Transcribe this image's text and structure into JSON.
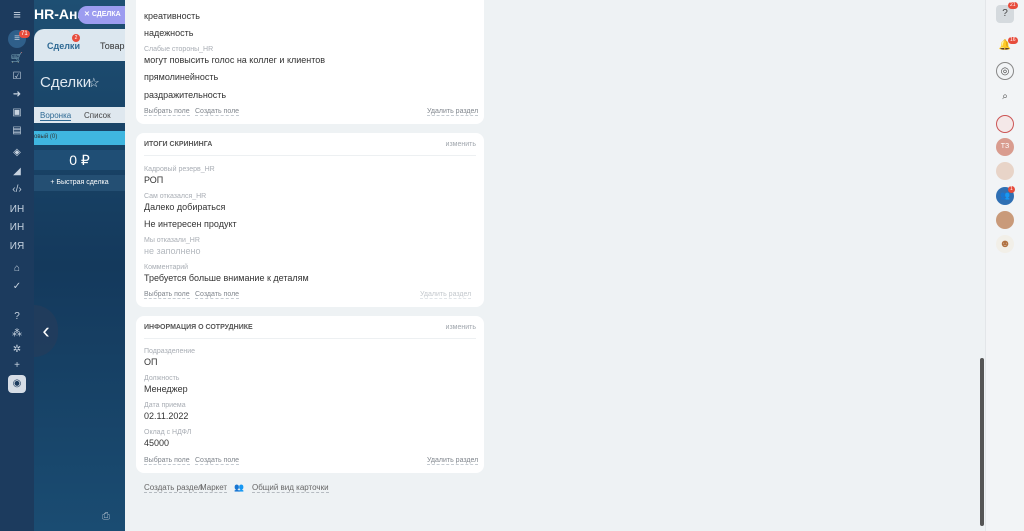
{
  "left_rail": {
    "menu_badge": "71",
    "items": [
      "ИН",
      "ИН",
      "ИЯ"
    ]
  },
  "background_app": {
    "title": "HR-Ана",
    "tabs": [
      {
        "label": "Сделки",
        "badge": "2"
      },
      {
        "label": "Товары"
      }
    ],
    "heading": "Сделки",
    "views": [
      "Воронка",
      "Список"
    ],
    "stage_label": "овый",
    "stage_count": "(0)",
    "sum": "0 ₽",
    "quick_deal": "Быстрая сделка"
  },
  "slider_chip": {
    "label": "СДЕЛКА"
  },
  "card1": {
    "fields": [
      {
        "value": "креативность"
      },
      {
        "value": "надежность"
      },
      {
        "label": "Слабые стороны_HR",
        "value": "могут повысить голос на коллег и клиентов"
      },
      {
        "value": "прямолинейность"
      },
      {
        "value": "раздражительность"
      }
    ],
    "footer": {
      "select": "Выбрать поле",
      "create": "Создать поле",
      "delete": "Удалить раздел"
    }
  },
  "card2": {
    "title": "ИТОГИ СКРИНИНГА",
    "edit": "изменить",
    "fields": [
      {
        "label": "Кадровый резерв_HR",
        "value": "РОП"
      },
      {
        "label": "Сам отказался_HR",
        "value": "Далеко добираться"
      },
      {
        "label": "",
        "value": "Не интересен продукт"
      },
      {
        "label": "Мы отказали_HR",
        "value": "не заполнено"
      },
      {
        "label": "Комментарий",
        "value": "Требуется больше внимание к деталям"
      }
    ],
    "footer": {
      "select": "Выбрать поле",
      "create": "Создать поле",
      "delete": "Удалить раздел"
    }
  },
  "card3": {
    "title": "ИНФОРМАЦИЯ О СОТРУДНИКЕ",
    "edit": "изменить",
    "fields": [
      {
        "label": "Подразделение",
        "value": "ОП"
      },
      {
        "label": "Должность",
        "value": "Менеджер"
      },
      {
        "label": "Дата приема",
        "value": "02.11.2022"
      },
      {
        "label": "Оклад с НДФЛ",
        "value": "45000"
      }
    ],
    "footer": {
      "select": "Выбрать поле",
      "create": "Создать поле",
      "delete": "Удалить раздел"
    }
  },
  "bottom_links": {
    "create_section": "Создать раздел",
    "market": "Маркет",
    "common_view": "Общий вид карточки"
  },
  "right_rail": {
    "help_badge": "21",
    "notifications_badge": "16",
    "avatar_initials": "ТЗ",
    "group_badge": "1"
  }
}
